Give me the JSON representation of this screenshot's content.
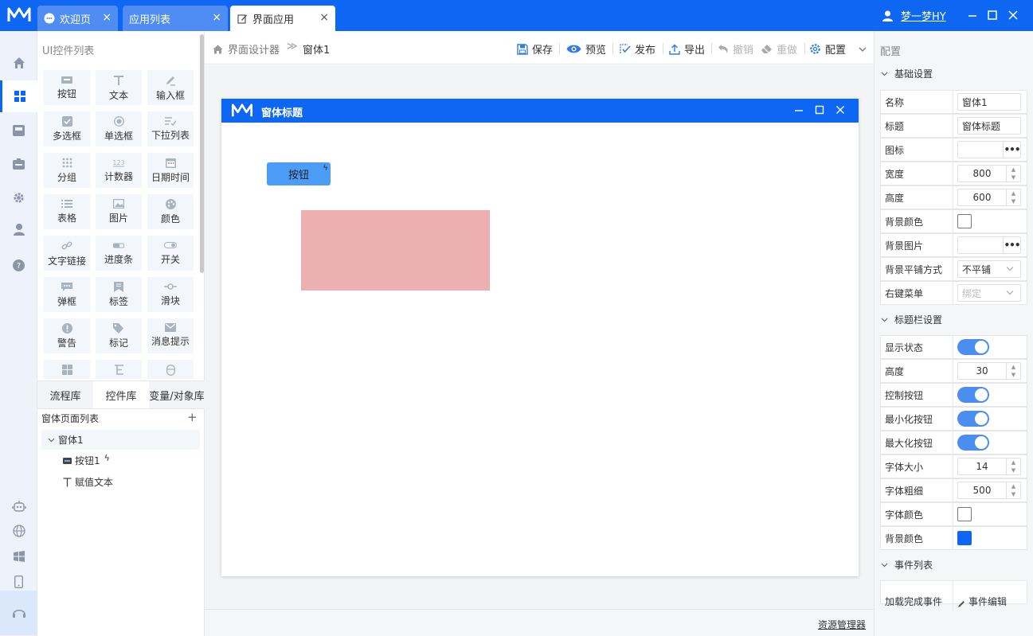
{
  "titlebar": {
    "tabs": [
      {
        "label": "欢迎页",
        "icon": "chat-icon"
      },
      {
        "label": "应用列表"
      },
      {
        "label": "界面应用",
        "icon": "edit-icon"
      }
    ],
    "close_glyph": "×",
    "user_name": "梦一梦HY"
  },
  "leftbar": {
    "items": [
      "home-icon",
      "grid-icon",
      "inbox-icon",
      "briefcase-icon",
      "gear-icon",
      "user-icon",
      "help-icon"
    ],
    "bottom_items": [
      "robot-icon",
      "globe-icon",
      "windows-icon",
      "mobile-icon",
      "headset-icon"
    ]
  },
  "panel": {
    "title": "UI控件列表",
    "controls": [
      "按钮",
      "文本",
      "输入框",
      "多选框",
      "单选框",
      "下拉列表",
      "分组",
      "计数器",
      "日期时间",
      "表格",
      "图片",
      "颜色",
      "文字链接",
      "进度条",
      "开关",
      "弹框",
      "标签",
      "滑块",
      "警告",
      "标记",
      "消息提示",
      "",
      "",
      ""
    ],
    "tabs": [
      "流程库",
      "控件库",
      "变量/对象库"
    ],
    "tree_title": "窗体页面列表",
    "tree_add": "+",
    "tree": {
      "root": "窗体1",
      "children": [
        {
          "label": "按钮1",
          "badge": "ϟ"
        },
        {
          "label": "赋值文本"
        }
      ]
    }
  },
  "breadcrumb": {
    "root": "界面设计器",
    "separator": "≫",
    "current": "窗体1"
  },
  "toolbar": {
    "save": "保存",
    "preview": "预览",
    "publish": "发布",
    "export": "导出",
    "undo": "撤销",
    "redo": "重做",
    "config": "配置"
  },
  "form": {
    "title": "窗体标题",
    "button_label": "按钮",
    "button_badge": "ϟ",
    "rect_color": "#ebb0af"
  },
  "status": {
    "resource_manager": "资源管理器"
  },
  "props": {
    "title": "配置",
    "basic_title": "基础设置",
    "basic": {
      "name_label": "名称",
      "name_value": "窗体1",
      "title_label": "标题",
      "title_value": "窗体标题",
      "icon_label": "图标",
      "width_label": "宽度",
      "width_value": "800",
      "height_label": "高度",
      "height_value": "600",
      "bg_color_label": "背景颜色",
      "bg_image_label": "背景图片",
      "bg_tile_label": "背景平铺方式",
      "bg_tile_value": "不平铺",
      "context_menu_label": "右键菜单",
      "context_menu_value": "绑定"
    },
    "titlebar_title": "标题栏设置",
    "titlebar_settings": {
      "show_label": "显示状态",
      "height_label": "高度",
      "height_value": "30",
      "control_btn_label": "控制按钮",
      "min_btn_label": "最小化按钮",
      "max_btn_label": "最大化按钮",
      "font_size_label": "字体大小",
      "font_size_value": "14",
      "font_weight_label": "字体粗细",
      "font_weight_value": "500",
      "font_color_label": "字体颜色",
      "bg_color_label": "背景颜色",
      "bg_color_value": "#0d67f2"
    },
    "events_title": "事件列表",
    "events": {
      "load_label": "加载完成事件",
      "edit_label": "事件编辑"
    },
    "more_glyph": "•••",
    "spin_up": "▲",
    "spin_down": "▼"
  },
  "colors": {
    "brand": "#0d67f2",
    "button": "#4c9df8",
    "toggle": "#4a8ef0"
  }
}
